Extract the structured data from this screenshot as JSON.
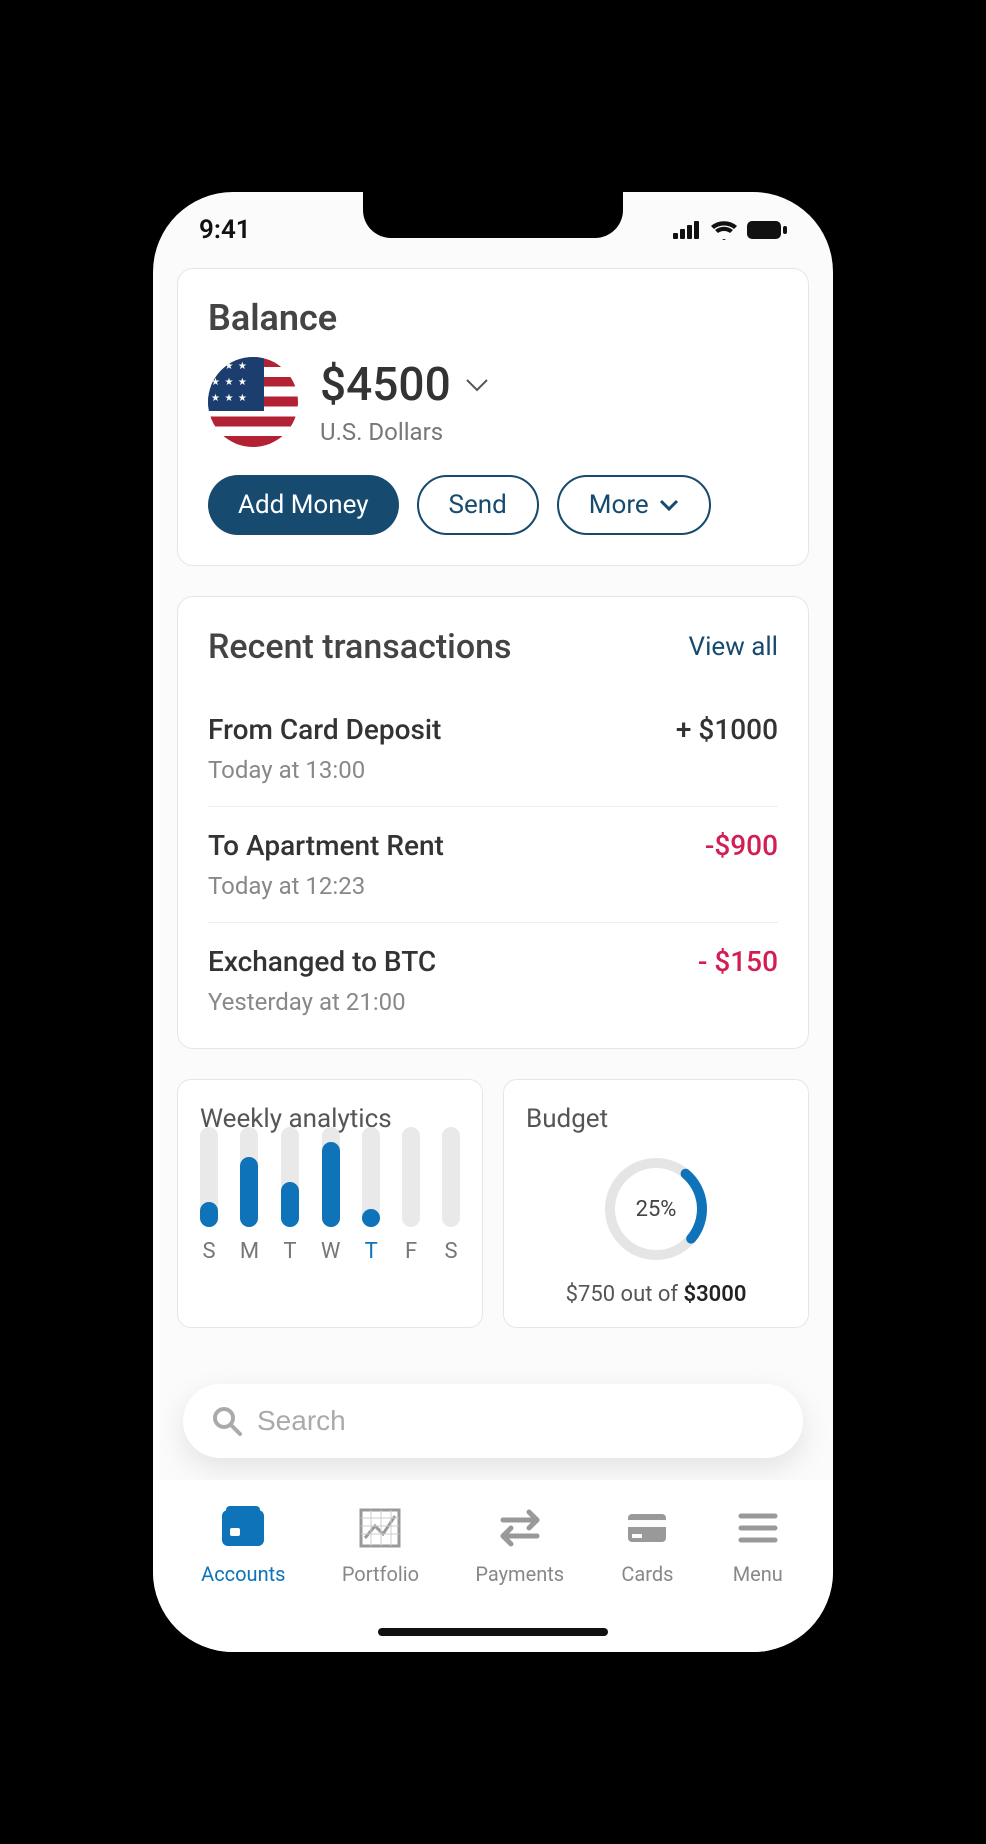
{
  "status": {
    "time": "9:41"
  },
  "balance": {
    "title": "Balance",
    "amount": "$4500",
    "currency": "U.S. Dollars",
    "buttons": {
      "add": "Add Money",
      "send": "Send",
      "more": "More"
    }
  },
  "transactions": {
    "title": "Recent transactions",
    "view_all": "View all",
    "items": [
      {
        "title": "From Card Deposit",
        "time": "Today at 13:00",
        "amount": "+ $1000",
        "negative": false
      },
      {
        "title": "To Apartment Rent",
        "time": "Today at 12:23",
        "amount": "-$900",
        "negative": true
      },
      {
        "title": "Exchanged to BTC",
        "time": "Yesterday at 21:00",
        "amount": "- $150",
        "negative": true
      }
    ]
  },
  "analytics": {
    "title": "Weekly analytics",
    "days": [
      {
        "label": "S",
        "value": 25,
        "active": false
      },
      {
        "label": "M",
        "value": 70,
        "active": false
      },
      {
        "label": "T",
        "value": 45,
        "active": false
      },
      {
        "label": "W",
        "value": 85,
        "active": false
      },
      {
        "label": "T",
        "value": 18,
        "active": true
      },
      {
        "label": "F",
        "value": 0,
        "active": false
      },
      {
        "label": "S",
        "value": 0,
        "active": false
      }
    ]
  },
  "budget": {
    "title": "Budget",
    "percent": 25,
    "percent_label": "25%",
    "spent": "$750",
    "out_of": "out of",
    "total": "$3000"
  },
  "search": {
    "placeholder": "Search"
  },
  "nav": {
    "items": [
      {
        "label": "Accounts",
        "active": true
      },
      {
        "label": "Portfolio",
        "active": false
      },
      {
        "label": "Payments",
        "active": false
      },
      {
        "label": "Cards",
        "active": false
      },
      {
        "label": "Menu",
        "active": false
      }
    ]
  },
  "chart_data": [
    {
      "type": "bar",
      "title": "Weekly analytics",
      "categories": [
        "S",
        "M",
        "T",
        "W",
        "T",
        "F",
        "S"
      ],
      "values": [
        25,
        70,
        45,
        85,
        18,
        0,
        0
      ],
      "ylim": [
        0,
        100
      ]
    },
    {
      "type": "pie",
      "title": "Budget",
      "series": [
        {
          "name": "used",
          "values": [
            25,
            75
          ]
        }
      ],
      "annotations": [
        "25%",
        "$750 out of $3000"
      ]
    }
  ]
}
